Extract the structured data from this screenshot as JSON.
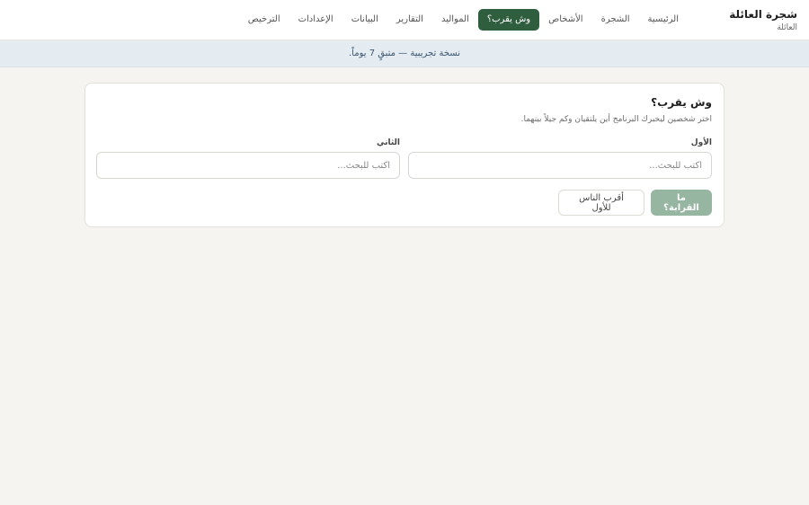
{
  "app": {
    "title": "شجرة العائلة",
    "subtitle": "العائلة"
  },
  "nav": {
    "items": [
      {
        "label": "الرئيسية",
        "active": false
      },
      {
        "label": "الشجرة",
        "active": false
      },
      {
        "label": "الأشخاص",
        "active": false
      },
      {
        "label": "وش يقرب؟",
        "active": true
      },
      {
        "label": "المواليد",
        "active": false
      },
      {
        "label": "التقارير",
        "active": false
      },
      {
        "label": "البيانات",
        "active": false
      },
      {
        "label": "الإعدادات",
        "active": false
      },
      {
        "label": "الترخيص",
        "active": false
      }
    ]
  },
  "banner": {
    "text": "نسخة تجريبية — متبقٍ 7 يوماً."
  },
  "relation_finder": {
    "title": "وش يقرب؟",
    "description": "اختر شخصين ليخبرك البرنامج أين يلتقيان وكم جيلاً بينهما.",
    "first": {
      "label": "الأول",
      "placeholder": "اكتب للبحث...",
      "value": ""
    },
    "second": {
      "label": "الثاني",
      "placeholder": "اكتب للبحث...",
      "value": ""
    },
    "primary_button": "ما القرابة؟",
    "secondary_button": "أقرب الناس للأول"
  },
  "colors": {
    "accent": "#2e5e3e",
    "primary_button_disabled": "#97b6a2",
    "banner_bg": "#e4ebf1",
    "page_bg": "#f5f4f0"
  }
}
